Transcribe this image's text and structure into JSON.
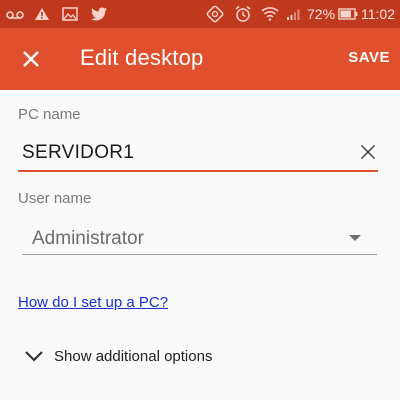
{
  "status_bar": {
    "battery_percent": "72%",
    "time": "11:02",
    "icons": [
      "voicemail-icon",
      "warning-icon",
      "gallery-icon",
      "twitter-icon",
      "sync-icon",
      "alarm-icon",
      "wifi-icon",
      "signal-icon",
      "battery-icon"
    ]
  },
  "app_bar": {
    "title": "Edit desktop",
    "save_label": "SAVE",
    "close_icon": "close-icon"
  },
  "form": {
    "pc_name": {
      "label": "PC name",
      "value": "SERVIDOR1"
    },
    "user_name": {
      "label": "User name",
      "value": "Administrator"
    },
    "help_link": "How do I set up a PC?",
    "more_options": "Show additional options"
  },
  "colors": {
    "status_bar": "#c0391f",
    "app_bar": "#e0502f",
    "accent": "#e0502f",
    "link": "#1a2fd0",
    "background": "#fafafa"
  }
}
